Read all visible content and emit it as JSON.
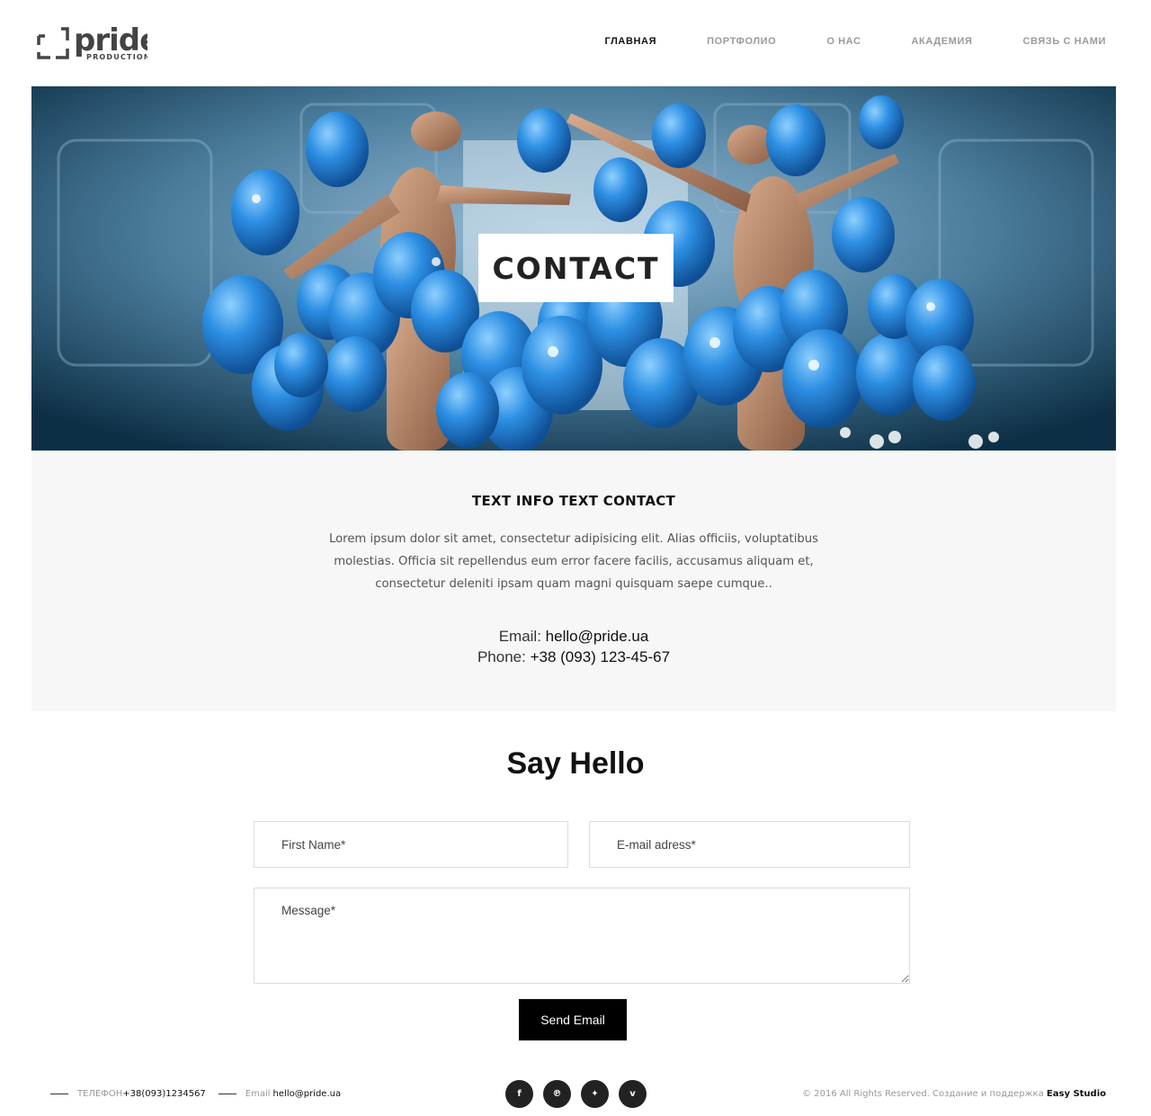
{
  "header": {
    "logo": {
      "word": "pride",
      "sub": "PRODUCTION"
    },
    "nav": [
      {
        "label": "ГЛАВНАЯ",
        "active": true
      },
      {
        "label": "ПОРТФОЛИО",
        "active": false
      },
      {
        "label": "О НАС",
        "active": false
      },
      {
        "label": "АКАДЕМИЯ",
        "active": false
      },
      {
        "label": "СВЯЗЬ С НАМИ",
        "active": false
      }
    ]
  },
  "hero": {
    "title": "CONTACT"
  },
  "info": {
    "heading": "TEXT INFO TEXT CONTACT",
    "text": "Lorem ipsum dolor sit amet, consectetur adipisicing elit. Alias officiis, voluptatibus molestias. Officia sit repellendus eum error facere facilis, accusamus aliquam et, consectetur deleniti ipsam quam magni quisquam saepe cumque..",
    "email_label": "Email: ",
    "email_value": "hello@pride.ua",
    "phone_label": "Phone: ",
    "phone_value": "+38 (093) 123-45-67"
  },
  "form": {
    "title": "Say Hello",
    "first_name_placeholder": "First Name*",
    "email_placeholder": "E-mail adress*",
    "message_placeholder": "Message*",
    "send_label": "Send Email"
  },
  "footer": {
    "phone_label": "ТЕЛЕФОН",
    "phone_value": "+38(093)1234567",
    "email_label": "Email ",
    "email_value": "hello@pride.ua",
    "socials": [
      {
        "icon": "facebook-icon",
        "glyph": "f"
      },
      {
        "icon": "pinterest-icon",
        "glyph": "℗"
      },
      {
        "icon": "twitter-icon",
        "glyph": "✦"
      },
      {
        "icon": "vimeo-icon",
        "glyph": "v"
      }
    ],
    "copyright": "© 2016 All Rights Reserved. Создание и поддержка ",
    "studio": "Easy Studio"
  },
  "colors": {
    "accent": "#000000",
    "panel": "#f7f7f7",
    "balloon": "#2f8fe0"
  }
}
